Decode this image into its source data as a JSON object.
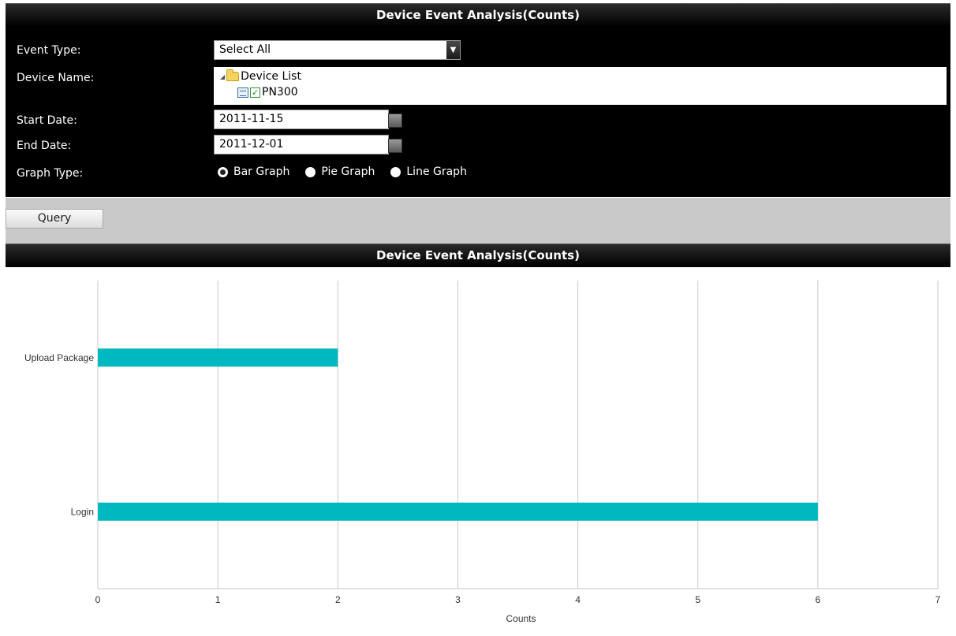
{
  "top_title": "Device Event Analysis(Counts)",
  "form": {
    "event_type_label": "Event Type:",
    "event_type_value": "Select All",
    "device_name_label": "Device Name:",
    "device_tree": {
      "root": "Device List",
      "child": "PN300"
    },
    "start_date_label": "Start Date:",
    "start_date_value": "2011-11-15",
    "end_date_label": "End Date:",
    "end_date_value": "2011-12-01",
    "graph_type_label": "Graph Type:",
    "graph_options": [
      "Bar Graph",
      "Pie Graph",
      "Line Graph"
    ],
    "graph_selected": "Bar Graph"
  },
  "query_label": "Query",
  "result_title": "Device Event Analysis(Counts)",
  "colors": {
    "bar": "#00b8c0",
    "header": "#000000",
    "toolbar": "#c9c9c9"
  },
  "chart_data": {
    "type": "bar",
    "orientation": "horizontal",
    "categories": [
      "Upload Package",
      "Login"
    ],
    "values": [
      2,
      6
    ],
    "xlabel": "Counts",
    "ylabel": "",
    "xlim": [
      0,
      7
    ],
    "xticks": [
      "0",
      "1",
      "2",
      "3",
      "4",
      "5",
      "6",
      "7"
    ],
    "grid": true
  }
}
